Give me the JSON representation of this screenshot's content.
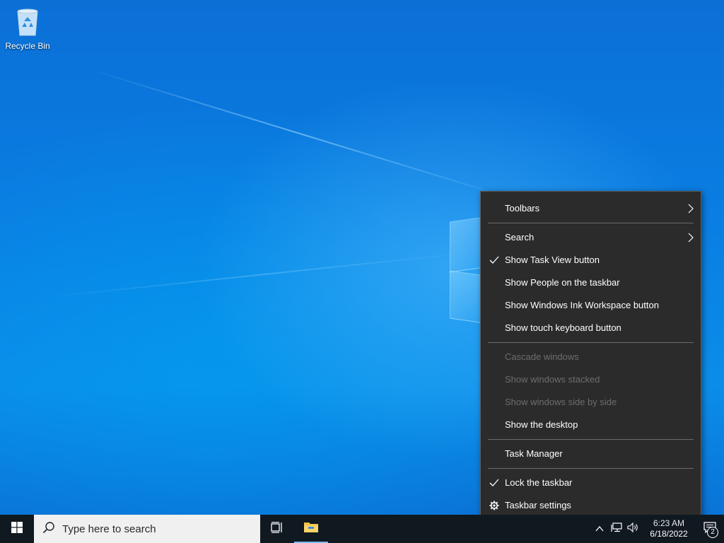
{
  "desktop": {
    "icons": [
      {
        "label": "Recycle Bin",
        "icon": "recycle-bin-icon"
      }
    ]
  },
  "context_menu": {
    "items": [
      {
        "label": "Toolbars",
        "checked": false,
        "disabled": false,
        "submenu": true
      },
      {
        "label": "Search",
        "checked": false,
        "disabled": false,
        "submenu": true
      },
      {
        "label": "Show Task View button",
        "checked": true,
        "disabled": false
      },
      {
        "label": "Show People on the taskbar",
        "checked": false,
        "disabled": false
      },
      {
        "label": "Show Windows Ink Workspace button",
        "checked": false,
        "disabled": false
      },
      {
        "label": "Show touch keyboard button",
        "checked": false,
        "disabled": false
      },
      {
        "label": "Cascade windows",
        "checked": false,
        "disabled": true
      },
      {
        "label": "Show windows stacked",
        "checked": false,
        "disabled": true
      },
      {
        "label": "Show windows side by side",
        "checked": false,
        "disabled": true
      },
      {
        "label": "Show the desktop",
        "checked": false,
        "disabled": false
      },
      {
        "label": "Task Manager",
        "checked": false,
        "disabled": false
      },
      {
        "label": "Lock the taskbar",
        "checked": true,
        "disabled": false
      },
      {
        "label": "Taskbar settings",
        "icon": "gear-icon",
        "disabled": false
      }
    ]
  },
  "taskbar": {
    "search_placeholder": "Type here to search",
    "clock_time": "6:23 AM",
    "clock_date": "6/18/2022",
    "notification_count": "2",
    "icons": [
      "windows-start-icon",
      "search-icon",
      "task-view-icon",
      "file-explorer-icon",
      "chevron-up-icon",
      "network-icon",
      "volume-icon",
      "notification-icon"
    ]
  },
  "colors": {
    "menu_bg": "#2b2b2b",
    "taskbar_bg": "#101820",
    "desktop_blue": "#0a7fe3",
    "disabled_text": "#6d6d6d"
  }
}
